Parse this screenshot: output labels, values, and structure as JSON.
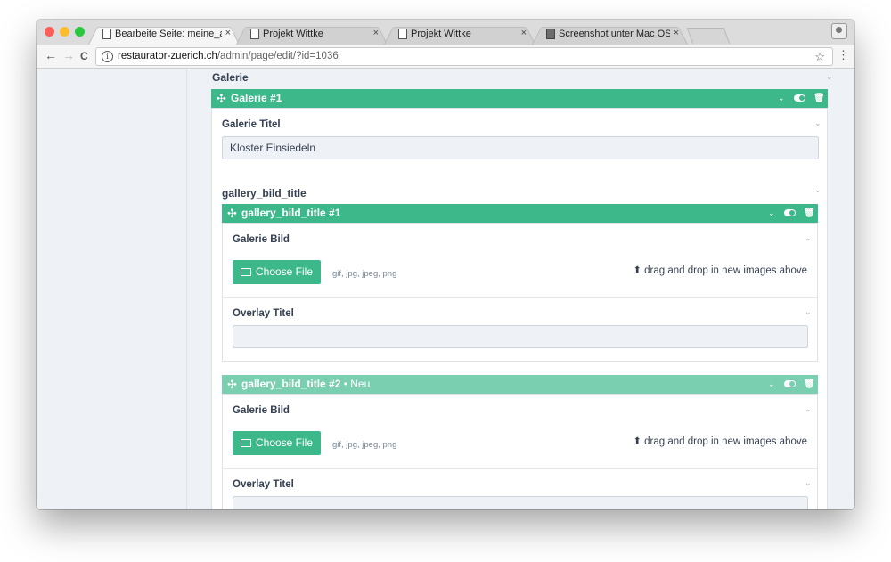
{
  "browser": {
    "tabs": [
      {
        "label": "Bearbeite Seite: meine_arbeit ·",
        "active": true
      },
      {
        "label": "Projekt Wittke",
        "active": false
      },
      {
        "label": "Projekt Wittke",
        "active": false
      },
      {
        "label": "Screenshot unter Mac OS - Ma",
        "active": false
      }
    ],
    "close_glyph": "×",
    "url_host": "restaurator-zuerich.ch",
    "url_path": "/admin/page/edit/?id=1036",
    "info_glyph": "i",
    "back_glyph": "←",
    "forward_glyph": "→",
    "reload_glyph": "C",
    "star_glyph": "☆",
    "menu_glyph": "⋮"
  },
  "colors": {
    "accent": "#3db88b",
    "accent_light": "#79cfb0",
    "text": "#354052",
    "page_bg": "#eef1f5"
  },
  "galerie": {
    "section_label": "Galerie",
    "block_title": "Galerie #1",
    "titel_label": "Galerie Titel",
    "titel_value": "Kloster Einsiedeln"
  },
  "gallery_bild": {
    "section_label": "gallery_bild_title",
    "items": [
      {
        "title": "gallery_bild_title #1",
        "suffix": "",
        "bild_label": "Galerie Bild",
        "choose_label": "Choose File",
        "file_types": "gif, jpg, jpeg, png",
        "dnd_hint": "drag and drop in new images above",
        "overlay_label": "Overlay Titel",
        "overlay_value": ""
      },
      {
        "title": "gallery_bild_title #2",
        "suffix": " • Neu",
        "bild_label": "Galerie Bild",
        "choose_label": "Choose File",
        "file_types": "gif, jpg, jpeg, png",
        "dnd_hint": "drag and drop in new images above",
        "overlay_label": "Overlay Titel",
        "overlay_value": ""
      }
    ]
  },
  "icons": {
    "move": "✣",
    "chevron": "⌄",
    "trash": "🗑",
    "upload": "⬆"
  }
}
